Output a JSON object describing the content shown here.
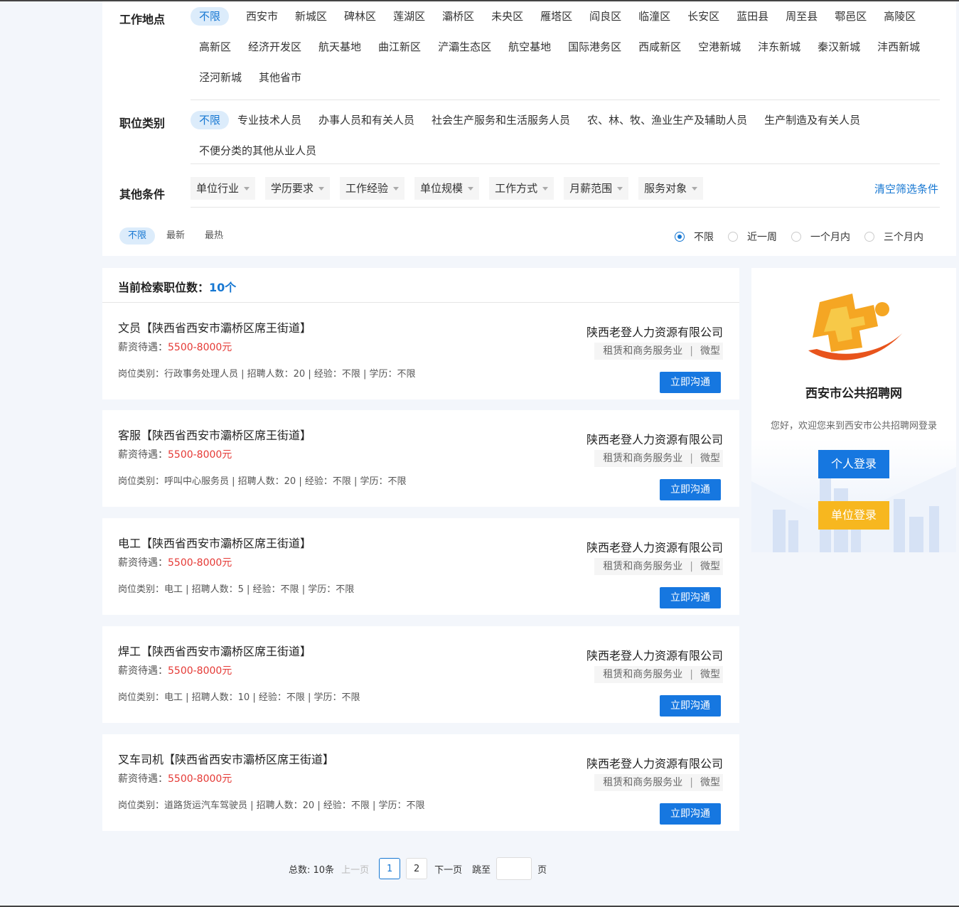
{
  "filters": {
    "location": {
      "label": "工作地点",
      "items": [
        "不限",
        "西安市",
        "新城区",
        "碑林区",
        "莲湖区",
        "灞桥区",
        "未央区",
        "雁塔区",
        "阎良区",
        "临潼区",
        "长安区",
        "蓝田县",
        "周至县",
        "鄠邑区",
        "高陵区",
        "高新区",
        "经济开发区",
        "航天基地",
        "曲江新区",
        "浐灞生态区",
        "航空基地",
        "国际港务区",
        "西咸新区",
        "空港新城",
        "沣东新城",
        "秦汉新城",
        "沣西新城",
        "泾河新城",
        "其他省市"
      ]
    },
    "category": {
      "label": "职位类别",
      "items": [
        "不限",
        "专业技术人员",
        "办事人员和有关人员",
        "社会生产服务和生活服务人员",
        "农、林、牧、渔业生产及辅助人员",
        "生产制造及有关人员",
        "不便分类的其他从业人员"
      ]
    },
    "other": {
      "label": "其他条件",
      "dropdowns": [
        "单位行业",
        "学历要求",
        "工作经验",
        "单位规模",
        "工作方式",
        "月薪范围",
        "服务对象"
      ],
      "clear_label": "清空筛选条件"
    },
    "sort": [
      "不限",
      "最新",
      "最热"
    ],
    "time": [
      "不限",
      "近一周",
      "一个月内",
      "三个月内"
    ]
  },
  "results": {
    "count_label": "当前检索职位数：",
    "count_value": "10个",
    "jobs": [
      {
        "title": "文员【陕西省西安市灞桥区席王街道】",
        "salary_label": "薪资待遇：",
        "salary": "5500-8000元",
        "meta": "岗位类别：行政事务处理人员 | 招聘人数：20 | 经验：不限 | 学历：不限",
        "company": "陕西老登人力资源有限公司",
        "industry": "租赁和商务服务业",
        "size": "微型",
        "button": "立即沟通"
      },
      {
        "title": "客服【陕西省西安市灞桥区席王街道】",
        "salary_label": "薪资待遇：",
        "salary": "5500-8000元",
        "meta": "岗位类别：呼叫中心服务员 | 招聘人数：20 | 经验：不限 | 学历：不限",
        "company": "陕西老登人力资源有限公司",
        "industry": "租赁和商务服务业",
        "size": "微型",
        "button": "立即沟通"
      },
      {
        "title": "电工【陕西省西安市灞桥区席王街道】",
        "salary_label": "薪资待遇：",
        "salary": "5500-8000元",
        "meta": "岗位类别：电工 | 招聘人数：5 | 经验：不限 | 学历：不限",
        "company": "陕西老登人力资源有限公司",
        "industry": "租赁和商务服务业",
        "size": "微型",
        "button": "立即沟通"
      },
      {
        "title": "焊工【陕西省西安市灞桥区席王街道】",
        "salary_label": "薪资待遇：",
        "salary": "5500-8000元",
        "meta": "岗位类别：电工 | 招聘人数：10 | 经验：不限 | 学历：不限",
        "company": "陕西老登人力资源有限公司",
        "industry": "租赁和商务服务业",
        "size": "微型",
        "button": "立即沟通"
      },
      {
        "title": "叉车司机【陕西省西安市灞桥区席王街道】",
        "salary_label": "薪资待遇：",
        "salary": "5500-8000元",
        "meta": "岗位类别：道路货运汽车驾驶员 | 招聘人数：20 | 经验：不限 | 学历：不限",
        "company": "陕西老登人力资源有限公司",
        "industry": "租赁和商务服务业",
        "size": "微型",
        "button": "立即沟通"
      }
    ]
  },
  "side": {
    "site_name": "西安市公共招聘网",
    "welcome": "您好，欢迎您来到西安市公共招聘网登录",
    "personal_login": "个人登录",
    "company_login": "单位登录"
  },
  "pagination": {
    "total": "总数: 10条",
    "prev": "上一页",
    "pages": [
      "1",
      "2"
    ],
    "next": "下一页",
    "jump_label": "跳至",
    "page_suffix": "页"
  },
  "colors": {
    "accent": "#1677d2",
    "salary": "#e53935",
    "login_company": "#f7b71f"
  }
}
